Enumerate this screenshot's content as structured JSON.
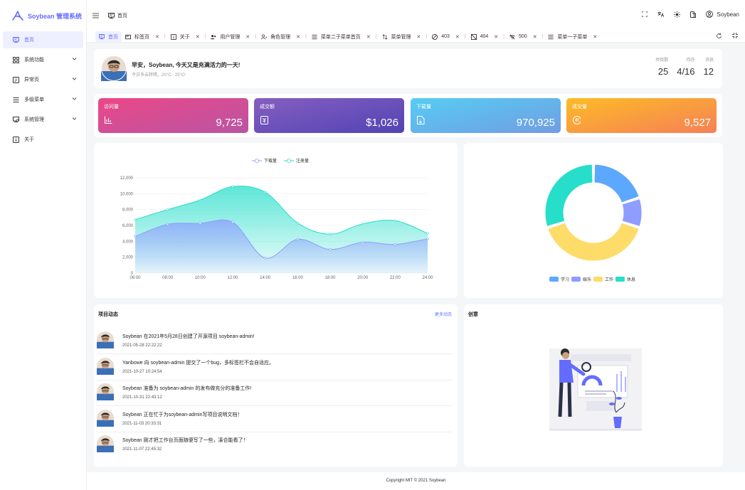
{
  "app": {
    "logo_text": "Soybean 管理系统"
  },
  "sidebar": {
    "items": [
      {
        "label": "首页",
        "icon": "monitor-icon",
        "active": true
      },
      {
        "label": "系统功能",
        "icon": "grid-icon",
        "has_children": true
      },
      {
        "label": "异常页",
        "icon": "error-page-icon",
        "has_children": true
      },
      {
        "label": "多级菜单",
        "icon": "menu-lines-icon",
        "has_children": true
      },
      {
        "label": "系统管理",
        "icon": "settings-monitor-icon",
        "has_children": true
      },
      {
        "label": "关于",
        "icon": "info-icon"
      }
    ]
  },
  "header": {
    "breadcrumb": "首页",
    "user_name": "Soybean"
  },
  "tabs": [
    {
      "label": "首页",
      "icon": "monitor-icon",
      "active": true
    },
    {
      "label": "标签页",
      "icon": "tab-icon"
    },
    {
      "label": "关于",
      "icon": "info-icon"
    },
    {
      "label": "用户管理",
      "icon": "users-icon"
    },
    {
      "label": "角色管理",
      "icon": "role-icon"
    },
    {
      "label": "菜单二子菜单首页",
      "icon": "menu-lines-icon"
    },
    {
      "label": "菜单管理",
      "icon": "sort-icon"
    },
    {
      "label": "403",
      "icon": "forbidden-icon"
    },
    {
      "label": "404",
      "icon": "not-found-icon"
    },
    {
      "label": "500",
      "icon": "wifi-off-icon"
    },
    {
      "label": "菜单一子菜单",
      "icon": "menu-lines-icon"
    }
  ],
  "welcome": {
    "greeting": "早安，Soybean, 今天又是充满活力的一天!",
    "weather": "今日多云转晴，20°C - 25°C!",
    "stats": [
      {
        "label": "项目数",
        "value": "25"
      },
      {
        "label": "待办",
        "value": "4/16"
      },
      {
        "label": "消息",
        "value": "12"
      }
    ]
  },
  "metrics": [
    {
      "label": "访问量",
      "value": "9,725",
      "icon": "bar-chart-icon",
      "colors": [
        "#ec4786",
        "#b955a4"
      ]
    },
    {
      "label": "成交额",
      "value": "$1,026",
      "icon": "money-icon",
      "colors": [
        "#865ec0",
        "#5144b4"
      ]
    },
    {
      "label": "下载量",
      "value": "970,925",
      "icon": "download-file-icon",
      "colors": [
        "#56cdf3",
        "#719de3"
      ]
    },
    {
      "label": "成交量",
      "value": "9,527",
      "icon": "deal-icon",
      "colors": [
        "#fcbc25",
        "#f68057"
      ]
    }
  ],
  "chart_data": [
    {
      "type": "area",
      "x": [
        "06:00",
        "08:00",
        "10:00",
        "12:00",
        "14:00",
        "16:00",
        "18:00",
        "20:00",
        "22:00",
        "24:00"
      ],
      "series": [
        {
          "name": "下载量",
          "color": "#8e9dff",
          "values": [
            4623,
            6145,
            6268,
            6411,
            1890,
            4251,
            2978,
            3880,
            3606,
            4311
          ]
        },
        {
          "name": "注册量",
          "color": "#26deca",
          "values": [
            6735,
            8000,
            9200,
            10900,
            10200,
            6300,
            4900,
            6200,
            6600,
            5000
          ]
        }
      ],
      "ylim": [
        0,
        12000
      ],
      "yticks": [
        0,
        2000,
        4000,
        6000,
        8000,
        10000,
        12000
      ],
      "ytick_labels": [
        "0",
        "2,000",
        "4,000",
        "6,000",
        "8,000",
        "10,000",
        "12,000"
      ],
      "grid": true,
      "legend": "top-center"
    },
    {
      "type": "pie",
      "donut": true,
      "categories": [
        "学习",
        "娱乐",
        "工作",
        "休息"
      ],
      "values": [
        20,
        10,
        40,
        30
      ],
      "colors": [
        "#5da8ff",
        "#8e9dff",
        "#fedc69",
        "#26deca"
      ],
      "legend": "bottom-center"
    }
  ],
  "news": {
    "title": "项目动态",
    "more_label": "更多动态",
    "items": [
      {
        "content": "Soybean 在2021年5月28日创建了开源项目 soybean-admin!",
        "time": "2021-05-28 22:22:22"
      },
      {
        "content": "Yanbowe 向 soybean-admin 提交了一个bug，多标签栏不会自适应。",
        "time": "2021-10-27 10:24:54"
      },
      {
        "content": "Soybean 准备为 soybean-admin 的发布做充分的准备工作!",
        "time": "2021-10-31 22:43:12"
      },
      {
        "content": "Soybean 正在忙于为soybean-admin写项目说明文档！",
        "time": "2021-11-03 20:33:31"
      },
      {
        "content": "Soybean 刚才把工作台页面随便写了一些，凑合能看了！",
        "time": "2021-11-07 22:45:32"
      }
    ]
  },
  "creativity": {
    "title": "创意"
  },
  "footer": {
    "text": "Copyright MIT © 2021 Soybean"
  }
}
